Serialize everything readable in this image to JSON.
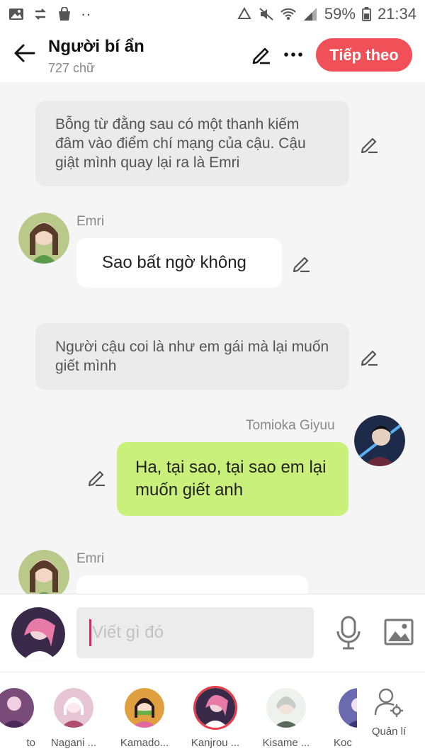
{
  "status_bar": {
    "battery": "59%",
    "time": "21:34",
    "icons": [
      "image-icon",
      "transfer-icon",
      "bag-icon",
      "more-dots-icon",
      "recycle-icon",
      "mute-icon",
      "wifi-icon",
      "signal-icon",
      "battery-icon"
    ]
  },
  "header": {
    "title": "Người bí ẩn",
    "subtitle": "727 chữ",
    "next_label": "Tiếp theo"
  },
  "messages": [
    {
      "type": "narration",
      "text": "Bỗng từ đằng sau có một thanh kiếm đâm vào điểm chí mạng của cậu. Cậu giật mình quay lại ra là Emri"
    },
    {
      "type": "left",
      "name": "Emri",
      "text": "Sao bất ngờ không"
    },
    {
      "type": "narration",
      "text": "Người cậu coi là như em gái mà lại muốn giết mình"
    },
    {
      "type": "right",
      "name": "Tomioka Giyuu",
      "text": "Ha, tại sao, tại sao em lại muốn giết anh"
    },
    {
      "type": "left",
      "name": "Emri",
      "text": ""
    }
  ],
  "input": {
    "placeholder": "Viết gì đó"
  },
  "characters": [
    {
      "label": "to",
      "color": "#7a4c7a"
    },
    {
      "label": "Nagani ...",
      "color": "#c7a0b5"
    },
    {
      "label": "Kamado...",
      "color": "#c9713a"
    },
    {
      "label": "Kanjrou ...",
      "color": "#c05a7a"
    },
    {
      "label": "Kisame ...",
      "color": "#9aa5a0"
    },
    {
      "label": "Koc",
      "color": "#6a6ab0"
    }
  ],
  "manage_label": "Quản lí",
  "colors": {
    "accent": "#f25058",
    "green_bubble": "#c9f07a",
    "narration_bg": "#ebebeb"
  }
}
